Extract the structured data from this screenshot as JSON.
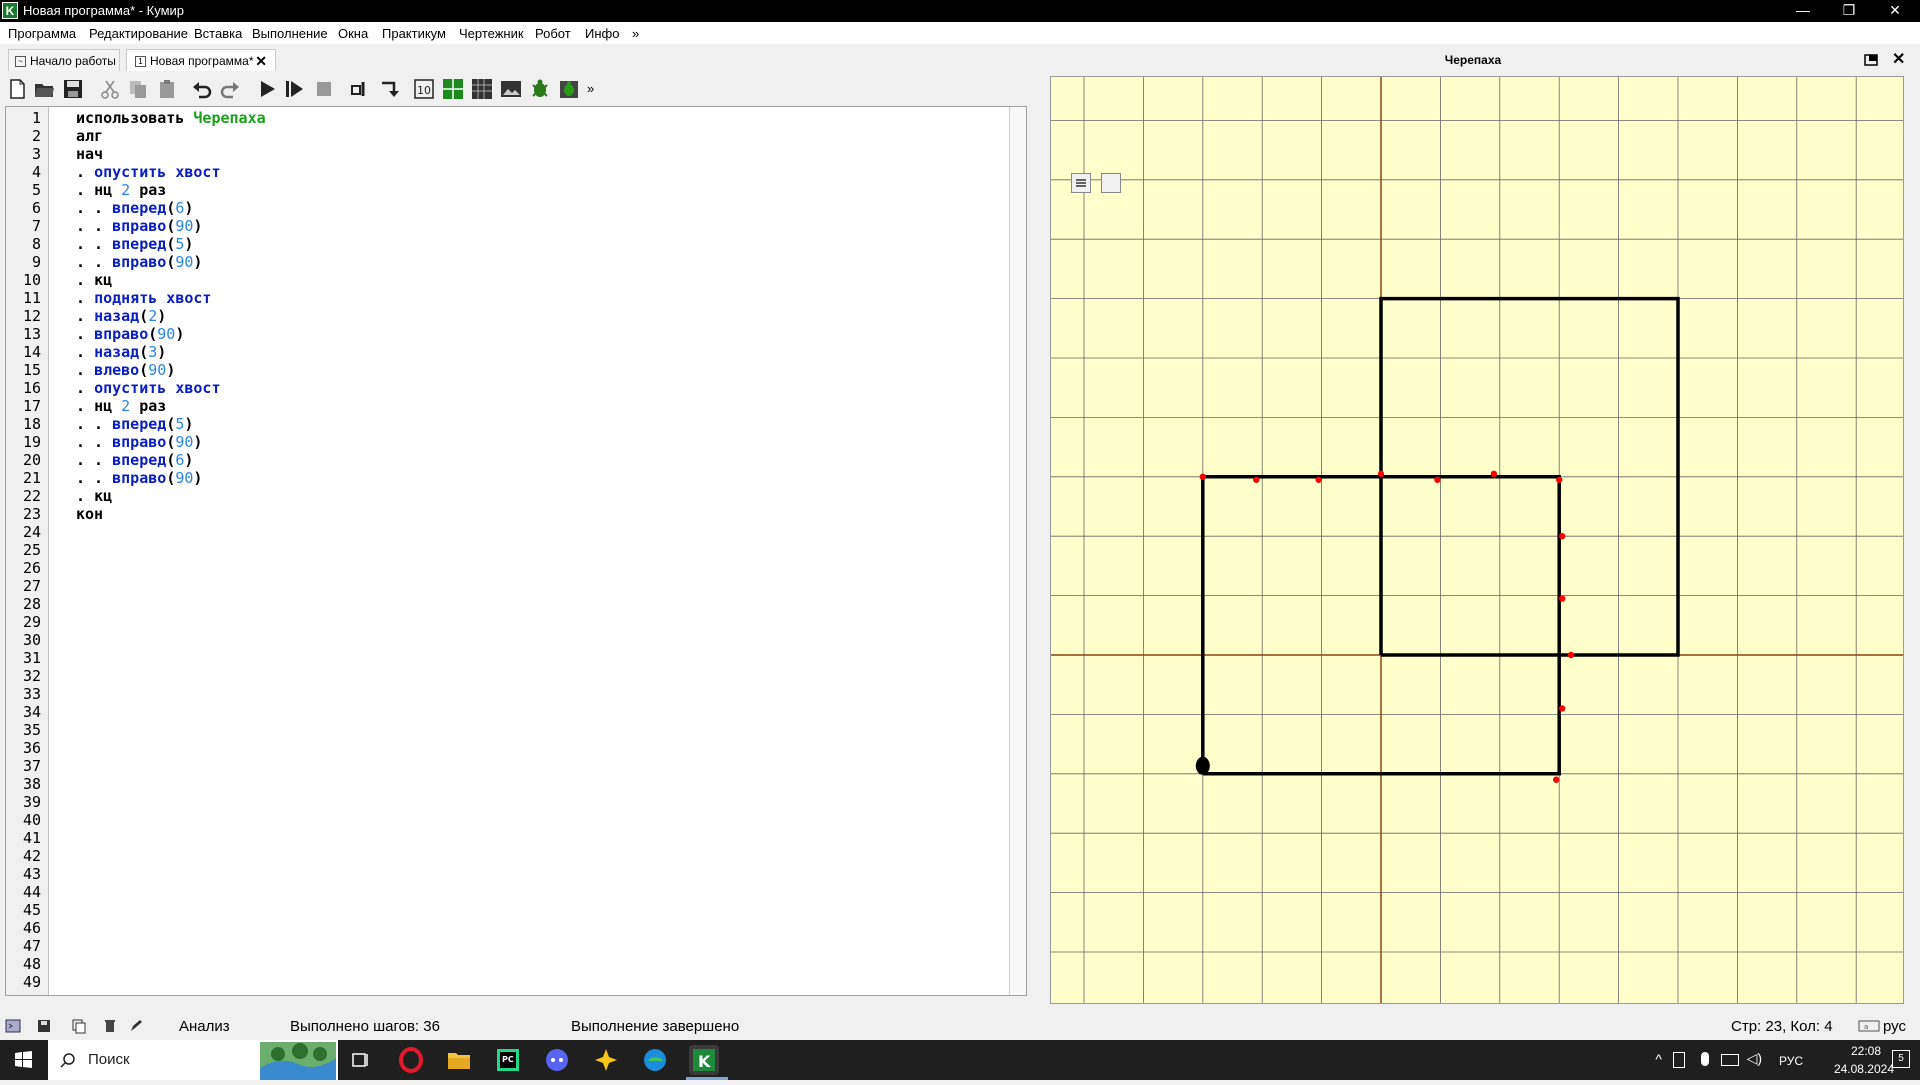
{
  "window": {
    "title": "Новая программа* - Кумир",
    "app_icon_letter": "K",
    "buttons": {
      "minimize": "—",
      "restore": "❐",
      "close": "✕"
    }
  },
  "menu": [
    "Программа",
    "Редактирование",
    "Вставка",
    "Выполнение",
    "Окна",
    "Практикум",
    "Чертежник",
    "Робот",
    "Инфо",
    "»"
  ],
  "tabs": [
    {
      "label": "Начало работы",
      "active": false
    },
    {
      "label": "Новая программа*",
      "active": true,
      "closable": true
    }
  ],
  "toolbar": {
    "icons": [
      "new-file-icon",
      "open-folder-icon",
      "save-icon",
      "cut-icon",
      "copy-icon",
      "paste-icon",
      "undo-icon",
      "redo-icon",
      "run-icon",
      "run-steps-icon",
      "stop-icon",
      "step-over-icon",
      "step-into-icon",
      "variables-icon",
      "robot-field-icon",
      "table-icon",
      "image-icon",
      "turtle-icon",
      "turtle-doc-icon"
    ],
    "more": "»"
  },
  "editor": {
    "line_numbers": [
      "1",
      "2",
      "3",
      "4",
      "5",
      "6",
      "7",
      "8",
      "9",
      "10",
      "11",
      "12",
      "13",
      "14",
      "15",
      "16",
      "17",
      "18",
      "19",
      "20",
      "21",
      "22",
      "23",
      "24",
      "25",
      "26",
      "27",
      "28",
      "29",
      "30",
      "31",
      "32",
      "33",
      "34",
      "35",
      "36",
      "37",
      "38",
      "39",
      "40",
      "41",
      "42",
      "43",
      "44",
      "45",
      "46",
      "47",
      "48",
      "49"
    ],
    "lines": [
      {
        "kw": "использовать ",
        "mod": "Черепаха"
      },
      {
        "kw": "алг"
      },
      {
        "kw": "нач"
      },
      {
        "indent": ". ",
        "cmd": "опустить хвост"
      },
      {
        "indent": ". ",
        "kw": "нц ",
        "num": "2",
        "kw2": " раз"
      },
      {
        "indent": ". . ",
        "cmd": "вперед",
        "open": "(",
        "num": "6",
        "close": ")"
      },
      {
        "indent": ". . ",
        "cmd": "вправо",
        "open": "(",
        "num": "90",
        "close": ")"
      },
      {
        "indent": ". . ",
        "cmd": "вперед",
        "open": "(",
        "num": "5",
        "close": ")"
      },
      {
        "indent": ". . ",
        "cmd": "вправо",
        "open": "(",
        "num": "90",
        "close": ")"
      },
      {
        "indent": ". ",
        "kw": "кц"
      },
      {
        "indent": ". ",
        "cmd": "поднять хвост"
      },
      {
        "indent": ". ",
        "cmd": "назад",
        "open": "(",
        "num": "2",
        "close": ")"
      },
      {
        "indent": ". ",
        "cmd": "вправо",
        "open": "(",
        "num": "90",
        "close": ")"
      },
      {
        "indent": ". ",
        "cmd": "назад",
        "open": "(",
        "num": "3",
        "close": ")"
      },
      {
        "indent": ". ",
        "cmd": "влево",
        "open": "(",
        "num": "90",
        "close": ")"
      },
      {
        "indent": ". ",
        "cmd": "опустить хвост"
      },
      {
        "indent": ". ",
        "kw": "нц ",
        "num": "2",
        "kw2": " раз"
      },
      {
        "indent": ". . ",
        "cmd": "вперед",
        "open": "(",
        "num": "5",
        "close": ")"
      },
      {
        "indent": ". . ",
        "cmd": "вправо",
        "open": "(",
        "num": "90",
        "close": ")"
      },
      {
        "indent": ". . ",
        "cmd": "вперед",
        "open": "(",
        "num": "6",
        "close": ")"
      },
      {
        "indent": ". . ",
        "cmd": "вправо",
        "open": "(",
        "num": "90",
        "close": ")"
      },
      {
        "indent": ". ",
        "kw": "кц"
      },
      {
        "kw": "кон"
      }
    ]
  },
  "turtle_panel": {
    "title": "Черепаха",
    "background_color": "#ffffcc",
    "grid_color": "#666666",
    "axis_color": "#8b4513",
    "path_color": "#000000",
    "marker_color": "#ff0000"
  },
  "status": {
    "analysis": "Анализ",
    "steps": "Выполнено шагов: 36",
    "result": "Выполнение завершено",
    "position": "Стр: 23, Кол: 4",
    "layout": "рус"
  },
  "taskbar": {
    "search_placeholder": "Поиск",
    "apps": [
      "task-view-icon",
      "opera-icon",
      "file-explorer-icon",
      "pycharm-icon",
      "discord-icon",
      "winamp-icon",
      "edge-icon",
      "kumir-icon"
    ],
    "lang": "РУС",
    "time": "22:08",
    "date": "24.08.2024",
    "notifications": "5"
  }
}
